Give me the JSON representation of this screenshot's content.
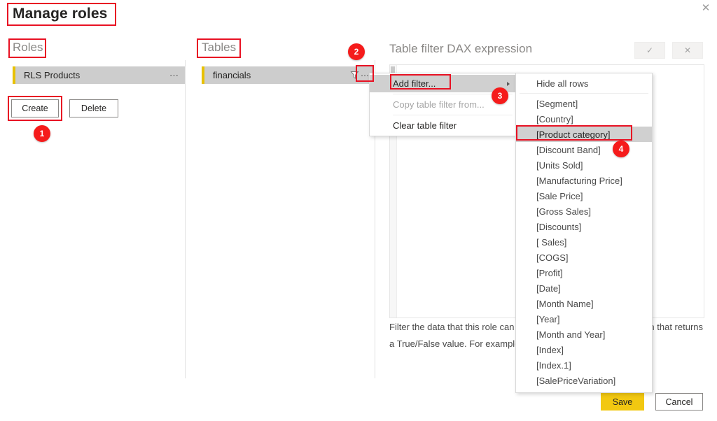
{
  "window": {
    "close_icon": "close-icon",
    "close_glyph": "✕"
  },
  "header": {
    "title": "Manage roles"
  },
  "roles_panel": {
    "heading": "Roles",
    "items": [
      {
        "label": "RLS Products",
        "ellipsis": "⋯"
      }
    ],
    "create_label": "Create",
    "delete_label": "Delete"
  },
  "tables_panel": {
    "heading": "Tables",
    "items": [
      {
        "label": "financials",
        "ellipsis": "⋯"
      }
    ]
  },
  "dax_panel": {
    "title": "Table filter DAX expression",
    "accept_glyph": "✓",
    "cancel_glyph": "✕",
    "expression": "",
    "help_text": "Filter the data that this role can see by entering a DAX expression that returns a True/False value. For example: [Entity ID] = \"Value\""
  },
  "context_menu": {
    "items": [
      {
        "label": "Add filter...",
        "state": "selected",
        "submenu": true
      },
      {
        "label": "Copy table filter from...",
        "state": "disabled",
        "submenu": false
      },
      {
        "label": "Clear table filter",
        "state": "normal",
        "submenu": false
      }
    ]
  },
  "field_menu": {
    "header_item": "Hide all rows",
    "items": [
      {
        "label": "[Segment]",
        "state": "normal"
      },
      {
        "label": "[Country]",
        "state": "normal"
      },
      {
        "label": "[Product category]",
        "state": "selected"
      },
      {
        "label": "[Discount Band]",
        "state": "normal"
      },
      {
        "label": "[Units Sold]",
        "state": "normal"
      },
      {
        "label": "[Manufacturing Price]",
        "state": "normal"
      },
      {
        "label": "[Sale Price]",
        "state": "normal"
      },
      {
        "label": "[Gross Sales]",
        "state": "normal"
      },
      {
        "label": "[Discounts]",
        "state": "normal"
      },
      {
        "label": "[ Sales]",
        "state": "normal"
      },
      {
        "label": "[COGS]",
        "state": "normal"
      },
      {
        "label": "[Profit]",
        "state": "normal"
      },
      {
        "label": "[Date]",
        "state": "normal"
      },
      {
        "label": "[Month Name]",
        "state": "normal"
      },
      {
        "label": "[Year]",
        "state": "normal"
      },
      {
        "label": "[Month and Year]",
        "state": "normal"
      },
      {
        "label": "[Index]",
        "state": "normal"
      },
      {
        "label": "[Index.1]",
        "state": "normal"
      },
      {
        "label": "[SalePriceVariation]",
        "state": "normal"
      }
    ]
  },
  "footer": {
    "save_label": "Save",
    "cancel_label": "Cancel"
  },
  "annotations": {
    "badges": [
      {
        "number": "1"
      },
      {
        "number": "2"
      },
      {
        "number": "3"
      },
      {
        "number": "4"
      }
    ]
  },
  "colors": {
    "accent_yellow": "#f2c811",
    "row_accent": "#e8c100",
    "annotation_red": "#e81123",
    "badge_red": "#f51b1b",
    "selected_gray": "#cdcdcd"
  }
}
